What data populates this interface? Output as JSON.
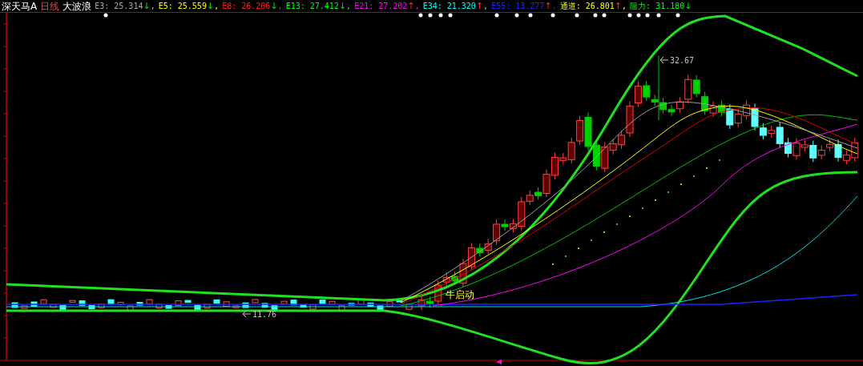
{
  "window": {
    "symbol": "深天马A",
    "period": "日线",
    "indicator": "大波浪"
  },
  "indicators": [
    {
      "kind": "falling",
      "label": "E3:",
      "value": "25.314",
      "arrow": "↓",
      "color": "#a8a8a8",
      "separator": ","
    },
    {
      "kind": "falling",
      "label": "E5:",
      "value": "25.559",
      "arrow": "↓",
      "color": "#ffff00",
      "separator": ","
    },
    {
      "kind": "falling",
      "label": "E8:",
      "value": "26.206",
      "arrow": "↓",
      "color": "#ff2020",
      "separator": ","
    },
    {
      "kind": "falling",
      "label": "E13:",
      "value": "27.412",
      "arrow": "↓",
      "color": "#00ff00",
      "separator": ","
    },
    {
      "kind": "rising",
      "label": "E21:",
      "value": "27.202",
      "arrow": "↑",
      "color": "#ff00ff",
      "separator": ","
    },
    {
      "kind": "rising",
      "label": "E34:",
      "value": "21.320",
      "arrow": "↑",
      "color": "#00ffff",
      "separator": ","
    },
    {
      "kind": "rising",
      "label": "E55:",
      "value": "13.277",
      "arrow": "↑",
      "color": "#2424ff",
      "separator": ","
    },
    {
      "kind": "rising",
      "label": "通道:",
      "value": "26.801",
      "arrow": "↑",
      "color": "#ffff00",
      "separator": ","
    },
    {
      "kind": "falling",
      "label": "阻力:",
      "value": "31.180",
      "arrow": "↓",
      "color": "#00ff00"
    }
  ],
  "chart": {
    "high_label": "32.67",
    "low_label": "11.76",
    "signal_label": "牛启动"
  }
}
